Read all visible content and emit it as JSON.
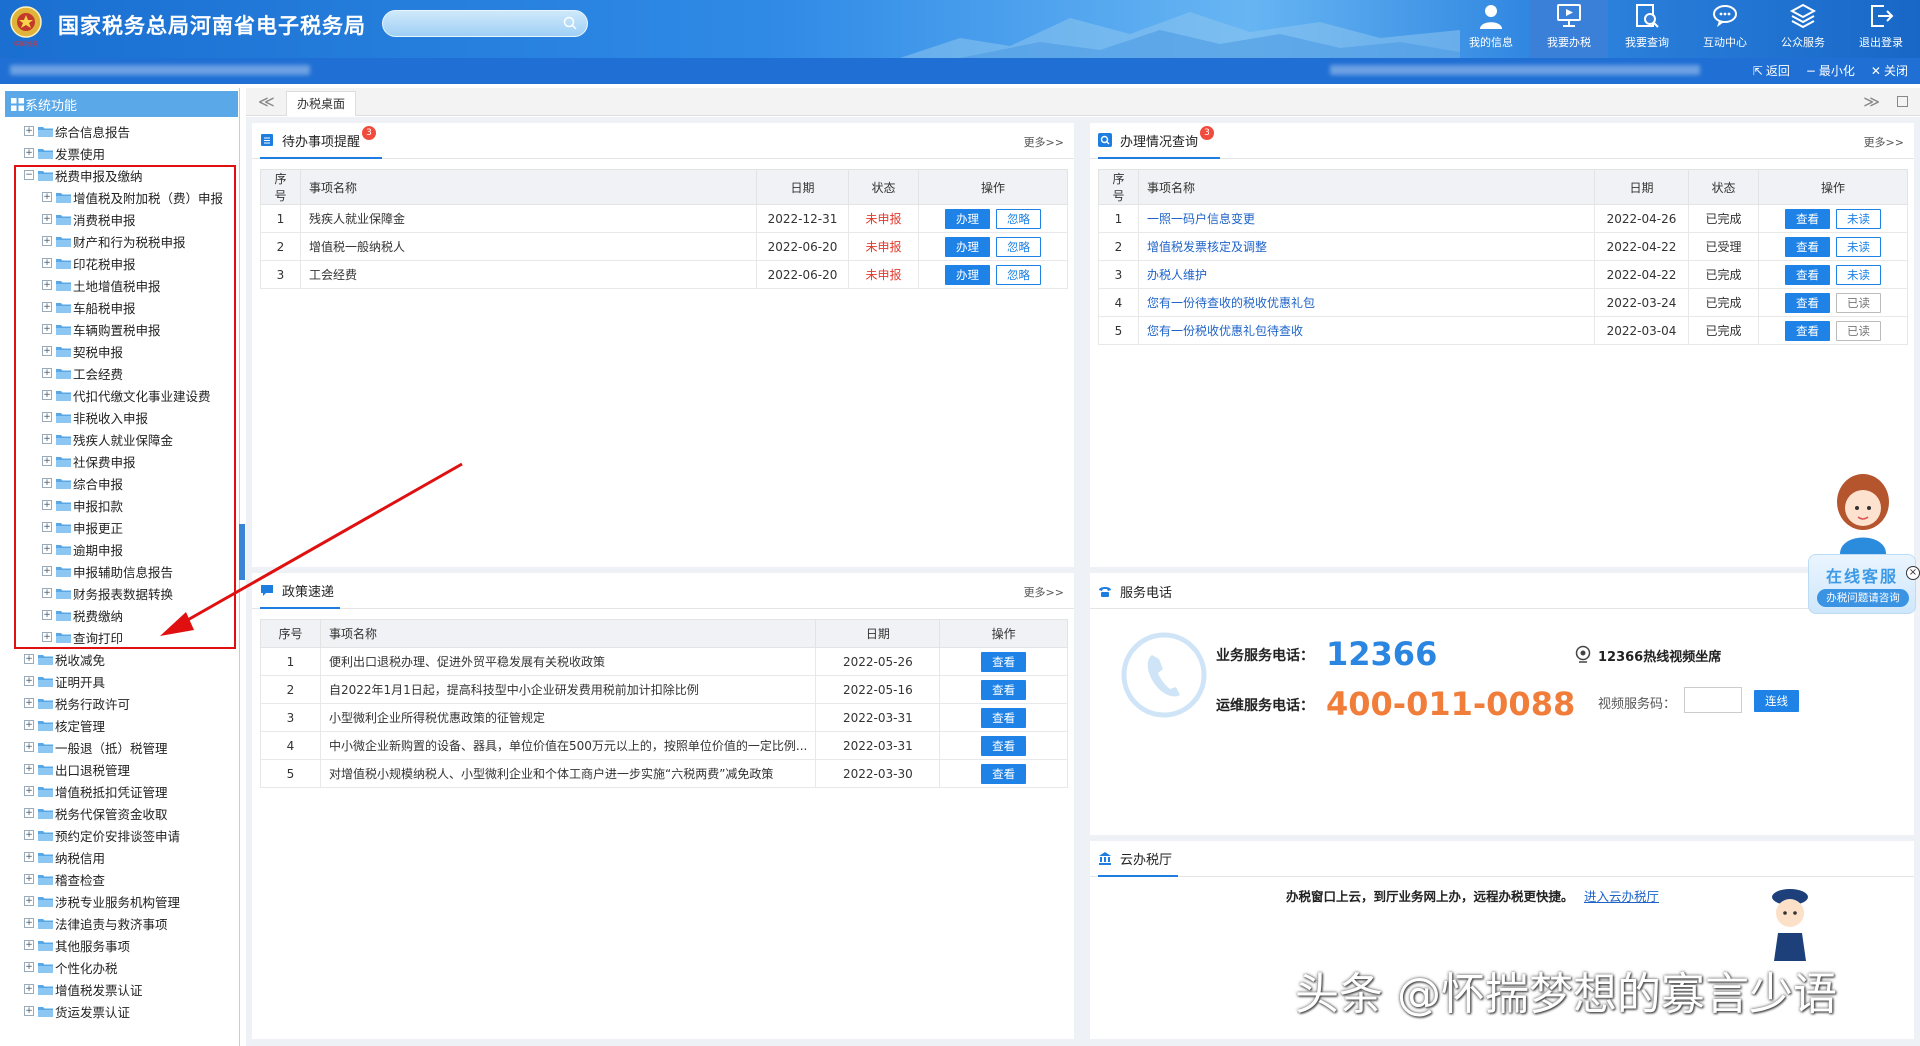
{
  "header": {
    "title": "国家税务总局河南省电子税务局",
    "logo_caption": "中国税务",
    "search_placeholder": "",
    "nav": [
      {
        "label": "我的信息",
        "icon": "user-icon"
      },
      {
        "label": "我要办税",
        "icon": "monitor-icon"
      },
      {
        "label": "我要查询",
        "icon": "query-icon"
      },
      {
        "label": "互动中心",
        "icon": "chat-icon"
      },
      {
        "label": "公众服务",
        "icon": "layers-icon"
      },
      {
        "label": "退出登录",
        "icon": "logout-icon"
      }
    ]
  },
  "subbar": {
    "back": "返回",
    "minimize": "最小化",
    "close": "关闭"
  },
  "sidebar": {
    "title": "系统功能",
    "items": [
      {
        "label": "综合信息报告",
        "level": 0,
        "open": false
      },
      {
        "label": "发票使用",
        "level": 0,
        "open": false
      },
      {
        "label": "税费申报及缴纳",
        "level": 0,
        "open": true
      },
      {
        "label": "增值税及附加税（费）申报",
        "level": 1,
        "open": false
      },
      {
        "label": "消费税申报",
        "level": 1,
        "open": false
      },
      {
        "label": "财产和行为税税申报",
        "level": 1,
        "open": false
      },
      {
        "label": "印花税申报",
        "level": 1,
        "open": false
      },
      {
        "label": "土地增值税申报",
        "level": 1,
        "open": false
      },
      {
        "label": "车船税申报",
        "level": 1,
        "open": false
      },
      {
        "label": "车辆购置税申报",
        "level": 1,
        "open": false
      },
      {
        "label": "契税申报",
        "level": 1,
        "open": false
      },
      {
        "label": "工会经费",
        "level": 1,
        "open": false
      },
      {
        "label": "代扣代缴文化事业建设费",
        "level": 1,
        "open": false
      },
      {
        "label": "非税收入申报",
        "level": 1,
        "open": false
      },
      {
        "label": "残疾人就业保障金",
        "level": 1,
        "open": false
      },
      {
        "label": "社保费申报",
        "level": 1,
        "open": false
      },
      {
        "label": "综合申报",
        "level": 1,
        "open": false
      },
      {
        "label": "申报扣款",
        "level": 1,
        "open": false
      },
      {
        "label": "申报更正",
        "level": 1,
        "open": false
      },
      {
        "label": "逾期申报",
        "level": 1,
        "open": false
      },
      {
        "label": "申报辅助信息报告",
        "level": 1,
        "open": false
      },
      {
        "label": "财务报表数据转换",
        "level": 1,
        "open": false
      },
      {
        "label": "税费缴纳",
        "level": 1,
        "open": false
      },
      {
        "label": "查询打印",
        "level": 1,
        "open": false
      },
      {
        "label": "税收减免",
        "level": 0,
        "open": false
      },
      {
        "label": "证明开具",
        "level": 0,
        "open": false
      },
      {
        "label": "税务行政许可",
        "level": 0,
        "open": false
      },
      {
        "label": "核定管理",
        "level": 0,
        "open": false
      },
      {
        "label": "一般退（抵）税管理",
        "level": 0,
        "open": false
      },
      {
        "label": "出口退税管理",
        "level": 0,
        "open": false
      },
      {
        "label": "增值税抵扣凭证管理",
        "level": 0,
        "open": false
      },
      {
        "label": "税务代保管资金收取",
        "level": 0,
        "open": false
      },
      {
        "label": "预约定价安排谈签申请",
        "level": 0,
        "open": false
      },
      {
        "label": "纳税信用",
        "level": 0,
        "open": false
      },
      {
        "label": "稽查检查",
        "level": 0,
        "open": false
      },
      {
        "label": "涉税专业服务机构管理",
        "level": 0,
        "open": false
      },
      {
        "label": "法律追责与救济事项",
        "level": 0,
        "open": false
      },
      {
        "label": "其他服务事项",
        "level": 0,
        "open": false
      },
      {
        "label": "个性化办税",
        "level": 0,
        "open": false
      },
      {
        "label": "增值税发票认证",
        "level": 0,
        "open": false
      },
      {
        "label": "货运发票认证",
        "level": 0,
        "open": false
      }
    ]
  },
  "tabs": {
    "collapse_left": "≪",
    "collapse_right": "≫",
    "active": "办税桌面"
  },
  "todo": {
    "title": "待办事项提醒",
    "badge": "3",
    "more": "更多>>",
    "columns": [
      "序号",
      "事项名称",
      "日期",
      "状态",
      "操作"
    ],
    "rows": [
      {
        "no": "1",
        "name": "残疾人就业保障金",
        "date": "2022-12-31",
        "status": "未申报",
        "btn1": "办理",
        "btn2": "忽略"
      },
      {
        "no": "2",
        "name": "增值税一般纳税人",
        "date": "2022-06-20",
        "status": "未申报",
        "btn1": "办理",
        "btn2": "忽略"
      },
      {
        "no": "3",
        "name": "工会经费",
        "date": "2022-06-20",
        "status": "未申报",
        "btn1": "办理",
        "btn2": "忽略"
      }
    ]
  },
  "progress": {
    "title": "办理情况查询",
    "badge": "3",
    "more": "更多>>",
    "columns": [
      "序号",
      "事项名称",
      "日期",
      "状态",
      "操作"
    ],
    "rows": [
      {
        "no": "1",
        "name": "一照一码户信息变更",
        "date": "2022-04-26",
        "status": "已完成",
        "btn1": "查看",
        "btn2": "未读"
      },
      {
        "no": "2",
        "name": "增值税发票核定及调整",
        "date": "2022-04-22",
        "status": "已受理",
        "btn1": "查看",
        "btn2": "未读"
      },
      {
        "no": "3",
        "name": "办税人维护",
        "date": "2022-04-22",
        "status": "已完成",
        "btn1": "查看",
        "btn2": "未读"
      },
      {
        "no": "4",
        "name": "您有一份待查收的税收优惠礼包",
        "date": "2022-03-24",
        "status": "已完成",
        "btn1": "查看",
        "btn2": "已读"
      },
      {
        "no": "5",
        "name": "您有一份税收优惠礼包待查收",
        "date": "2022-03-04",
        "status": "已完成",
        "btn1": "查看",
        "btn2": "已读"
      }
    ]
  },
  "policy": {
    "title": "政策速递",
    "more": "更多>>",
    "columns": [
      "序号",
      "事项名称",
      "日期",
      "操作"
    ],
    "rows": [
      {
        "no": "1",
        "name": "便利出口退税办理、促进外贸平稳发展有关税收政策",
        "date": "2022-05-26",
        "btn": "查看"
      },
      {
        "no": "2",
        "name": "自2022年1月1日起，提高科技型中小企业研发费用税前加计扣除比例",
        "date": "2022-05-16",
        "btn": "查看"
      },
      {
        "no": "3",
        "name": "小型微利企业所得税优惠政策的征管规定",
        "date": "2022-03-31",
        "btn": "查看"
      },
      {
        "no": "4",
        "name": "中小微企业新购置的设备、器具，单位价值在500万元以上的，按照单位价值的一定比例...",
        "date": "2022-03-31",
        "btn": "查看"
      },
      {
        "no": "5",
        "name": "对增值税小规模纳税人、小型微利企业和个体工商户进一步实施“六税两费”减免政策",
        "date": "2022-03-30",
        "btn": "查看"
      }
    ]
  },
  "service": {
    "title": "服务电话",
    "business_label": "业务服务电话：",
    "business_number": "12366",
    "ops_label": "运维服务电话：",
    "ops_number": "400-011-0088",
    "video_title": "12366热线视频坐席",
    "video_code_label": "视频服务码：",
    "video_code_value": "",
    "connect": "连线",
    "colors": {
      "business": "#2a86e0",
      "ops": "#f07d3a"
    }
  },
  "cloud": {
    "title": "云办税厅",
    "text": "办税窗口上云，到厅业务网上办，远程办税更快捷。",
    "link": "进入云办税厅"
  },
  "cs_widget": {
    "title": "在线客服",
    "subtitle": "办税问题请咨询",
    "close": "×"
  },
  "watermark": "头条 @怀揣梦想的寡言少语"
}
